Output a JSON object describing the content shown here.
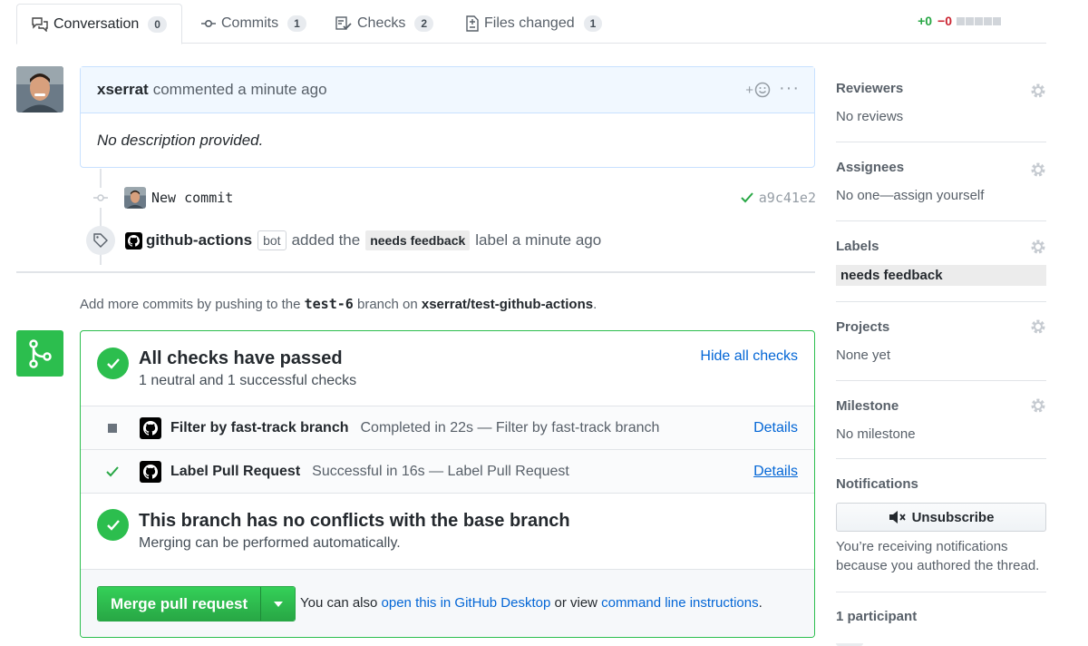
{
  "tabs": [
    {
      "label": "Conversation",
      "count": "0",
      "icon": "comment-discussion-icon"
    },
    {
      "label": "Commits",
      "count": "1",
      "icon": "git-commit-icon"
    },
    {
      "label": "Checks",
      "count": "2",
      "icon": "checklist-icon"
    },
    {
      "label": "Files changed",
      "count": "1",
      "icon": "file-diff-icon"
    }
  ],
  "diffstat": {
    "additions": "+0",
    "deletions": "−0"
  },
  "comment": {
    "author": "xserrat",
    "action": "commented a minute ago",
    "body": "No description provided.",
    "reaction_plus": "+"
  },
  "commit": {
    "message": "New commit",
    "sha": "a9c41e2"
  },
  "label_event": {
    "actor": "github-actions",
    "bot_badge": "bot",
    "action_pre": "added the",
    "label": "needs feedback",
    "action_post": "label a minute ago"
  },
  "push_note": {
    "pre": "Add more commits by pushing to the",
    "branch": "test-6",
    "mid": "branch on",
    "repo": "xserrat/test-github-actions",
    "post": "."
  },
  "checks": {
    "title": "All checks have passed",
    "subtitle": "1 neutral and 1 successful checks",
    "toggle": "Hide all checks",
    "items": [
      {
        "name": "Filter by fast-track branch",
        "desc": "Completed in 22s — Filter by fast-track branch",
        "details": "Details",
        "status": "neutral"
      },
      {
        "name": "Label Pull Request",
        "desc": "Successful in 16s — Label Pull Request",
        "details": "Details",
        "status": "success"
      }
    ]
  },
  "conflicts": {
    "title": "This branch has no conflicts with the base branch",
    "subtitle": "Merging can be performed automatically."
  },
  "merge": {
    "button": "Merge pull request",
    "note_pre": "You can also",
    "link_desktop": "open this in GitHub Desktop",
    "note_mid": "or view",
    "link_cli": "command line instructions",
    "note_post": "."
  },
  "sidebar": {
    "reviewers": {
      "title": "Reviewers",
      "value": "No reviews"
    },
    "assignees": {
      "title": "Assignees",
      "value": "No one—assign yourself"
    },
    "labels": {
      "title": "Labels",
      "value": "needs feedback"
    },
    "projects": {
      "title": "Projects",
      "value": "None yet"
    },
    "milestone": {
      "title": "Milestone",
      "value": "No milestone"
    },
    "notifications": {
      "title": "Notifications",
      "button": "Unsubscribe",
      "text": "You’re receiving notifications because you authored the thread."
    },
    "participants": {
      "title": "1 participant"
    }
  },
  "colors": {
    "accent": "#0366d6",
    "success": "#2cbe4e",
    "danger": "#cb2431"
  }
}
